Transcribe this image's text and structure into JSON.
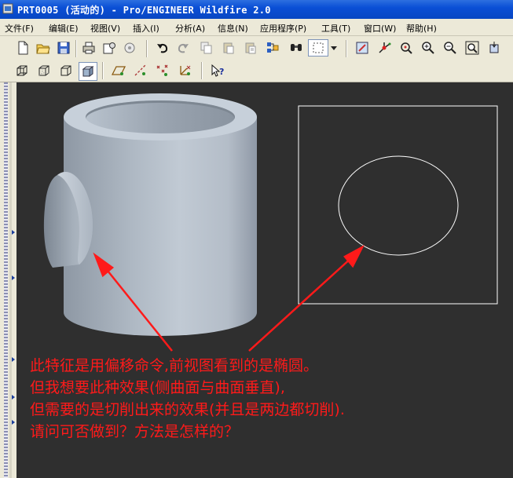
{
  "window": {
    "title": "PRT0005 (活动的) - Pro/ENGINEER Wildfire 2.0"
  },
  "menubar": {
    "items": [
      {
        "label": "文件(F)",
        "name": "menu-file"
      },
      {
        "label": "编辑(E)",
        "name": "menu-edit"
      },
      {
        "label": "视图(V)",
        "name": "menu-view"
      },
      {
        "label": "插入(I)",
        "name": "menu-insert"
      },
      {
        "label": "分析(A)",
        "name": "menu-analysis"
      },
      {
        "label": "信息(N)",
        "name": "menu-info"
      },
      {
        "label": "应用程序(P)",
        "name": "menu-applications"
      },
      {
        "label": "工具(T)",
        "name": "menu-tools"
      },
      {
        "label": "窗口(W)",
        "name": "menu-window"
      },
      {
        "label": "帮助(H)",
        "name": "menu-help"
      }
    ]
  },
  "toolbar_icons": [
    "new-file-icon",
    "open-folder-icon",
    "save-icon",
    "print-icon",
    "send-mail-icon",
    "regenerate-icon",
    "undo-icon",
    "redo-icon",
    "copy-icon",
    "paste-icon",
    "paste-special-icon",
    "regenerate-manager-icon",
    "find-icon",
    "select-box-icon",
    "dropdown-arrow-icon",
    "repaint-icon",
    "spin-center-icon",
    "orient-mode-icon",
    "zoom-in-icon",
    "zoom-out-icon",
    "refit-icon",
    "reorient-icon",
    "wireframe-icon",
    "hidden-line-icon",
    "no-hidden-icon",
    "shading-icon",
    "datum-planes-icon",
    "datum-axes-icon",
    "datum-points-icon",
    "coordinate-systems-icon",
    "context-help-icon"
  ],
  "colors": {
    "viewport_bg": "#2f2f2f",
    "model_body": "#a9b3bf",
    "annotation": "#ff1a1a",
    "sketch_line": "#ffffff"
  },
  "annotation": {
    "lines": [
      "此特征是用偏移命令,前视图看到的是椭圆。",
      "但我想要此种效果(侧曲面与曲面垂直),",
      "但需要的是切削出来的效果(并且是两边都切削).",
      "请问可否做到？方法是怎样的？"
    ]
  }
}
